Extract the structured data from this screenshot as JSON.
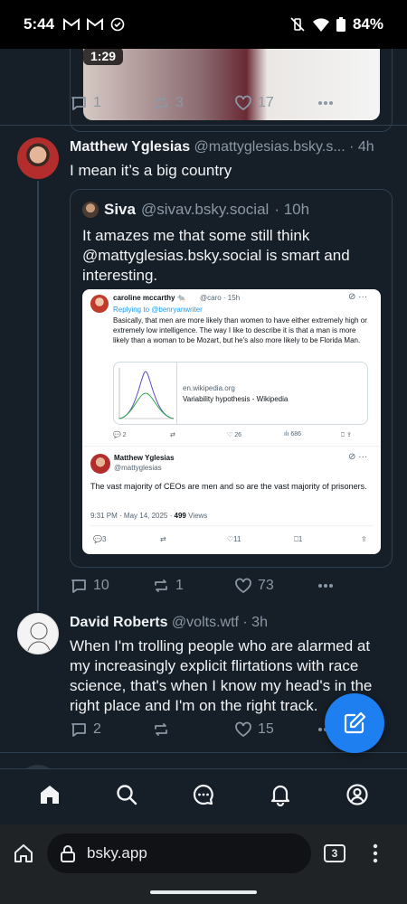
{
  "status_bar": {
    "time": "5:44",
    "battery": "84%"
  },
  "prev_post": {
    "video_time": "1:29",
    "actions": {
      "replies": "1",
      "reposts": "3",
      "likes": "17"
    }
  },
  "post1": {
    "name": "Matthew Yglesias",
    "handle": "@mattyglesias.bsky.s...",
    "time": "· 4h",
    "text": "I mean it’s a big country",
    "quote": {
      "name": "Siva",
      "handle": "@sivav.bsky.social",
      "time": "· 10h",
      "text": "It amazes me that some still think @mattyglesias.bsky.social is smart and interesting.",
      "embedded_tweet": {
        "author": "caroline mccarthy 🐀",
        "author_handle": "@caro · 15h",
        "replying": "Replying to @benryanwriter",
        "body": "Basically, that men are more likely than women to have either extremely high or extremely low intelligence. The way I like to describe it is that a man is more likely than a woman to be Mozart, but he's also more likely to be Florida Man.",
        "link_domain": "en.wikipedia.org",
        "link_title": "Variability hypothesis - Wikipedia",
        "stats": {
          "replies": "2",
          "likes": "26",
          "views": "686"
        },
        "reply_name": "Matthew Yglesias",
        "reply_handle": "@mattyglesias",
        "reply_body": "The vast majority of CEOs are men and so are the vast majority of prisoners.",
        "reply_meta": "9:31 PM · May 14, 2025 ·",
        "reply_views": "499",
        "reply_views_label": "Views",
        "reply_stats": {
          "replies": "3",
          "likes": "11",
          "bookmarks": "1"
        }
      }
    },
    "actions": {
      "replies": "10",
      "reposts": "1",
      "likes": "73"
    }
  },
  "post2": {
    "name": "David Roberts",
    "handle": "@volts.wtf",
    "time": "· 3h",
    "text": "When I'm trolling people who are alarmed at my increasingly explicit flirtations with race science, that's when I know my head's in the right place and I'm on the right track.",
    "actions": {
      "replies": "2",
      "likes": "15"
    }
  },
  "browser": {
    "url": "bsky.app",
    "tab_count": "3"
  },
  "colors": {
    "background": "#161e27",
    "accent": "#1d7ff0",
    "muted": "#8b98a5"
  },
  "icons": [
    "home-icon",
    "search-icon",
    "chat-icon",
    "bell-icon",
    "profile-icon",
    "compose-icon"
  ]
}
